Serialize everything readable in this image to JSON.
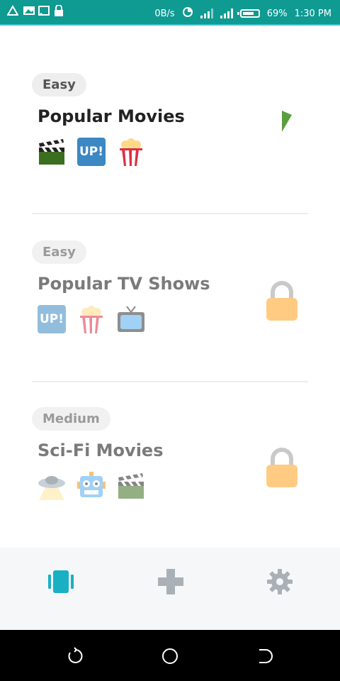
{
  "status_bar": {
    "net_speed": "0B/s",
    "battery_percent": "69%",
    "time": "1:30 PM",
    "bg_color": "#0f9a92"
  },
  "categories": [
    {
      "difficulty": "Easy",
      "title": "Popular Movies",
      "icons": [
        "clapper-board-icon",
        "up-button-icon",
        "popcorn-icon"
      ],
      "locked": false
    },
    {
      "difficulty": "Easy",
      "title": "Popular TV Shows",
      "icons": [
        "up-button-icon",
        "popcorn-icon",
        "television-icon"
      ],
      "locked": true
    },
    {
      "difficulty": "Medium",
      "title": "Sci-Fi Movies",
      "icons": [
        "flying-saucer-icon",
        "robot-icon",
        "clapper-board-icon"
      ],
      "locked": true
    }
  ],
  "up_text": "UP!",
  "bottom_nav": {
    "items": [
      "cards-icon",
      "gamepad-icon",
      "settings-gear-icon"
    ],
    "active_color": "#1ab0c4",
    "inactive_color": "#a9b0b6"
  }
}
